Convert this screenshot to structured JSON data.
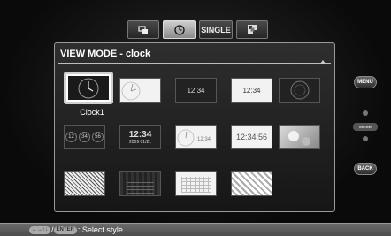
{
  "tabs": [
    {
      "label": "",
      "icon": "slideshow-icon",
      "active": false
    },
    {
      "label": "",
      "icon": "clock-icon",
      "active": true
    },
    {
      "label": "SINGLE",
      "icon": "",
      "active": false
    },
    {
      "label": "",
      "icon": "grid-icon",
      "active": false
    }
  ],
  "panel": {
    "title": "VIEW MODE - clock",
    "selected_label": "Clock1"
  },
  "thumbs": {
    "t3_time": "12:34",
    "t9_time": "12:34",
    "t9_date": "2009 01/21",
    "t11_text": "12:34",
    "t13_text": "12:34:56",
    "t8_a": "12",
    "t8_b": "34",
    "t8_c": "56",
    "t6_num": "12\n34"
  },
  "side": {
    "menu_label": "MENU",
    "enter_label": "ENTER",
    "back_label": "BACK"
  },
  "help": {
    "key_arrows": "←→↑↓",
    "key_enter": "ENTER",
    "text": ": Select style."
  }
}
